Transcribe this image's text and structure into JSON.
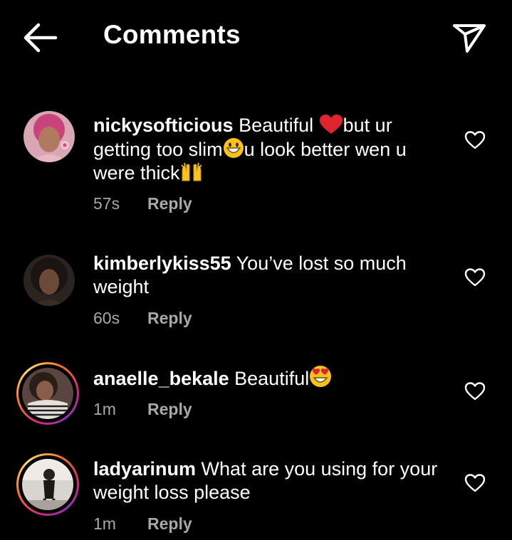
{
  "header": {
    "title": "Comments",
    "back_icon": "back-arrow-icon",
    "send_icon": "direct-send-icon"
  },
  "comments": [
    {
      "username": "nickysofticious",
      "text_1": " Beautiful ",
      "emoji_1": "red-heart",
      "text_2": "but ur getting too slim",
      "emoji_2": "grinning-face",
      "text_3": "u look better wen u were thick",
      "emoji_3": "raised-hands",
      "time": "57s",
      "reply_label": "Reply"
    },
    {
      "username": "kimberlykiss55",
      "text_1": " You’ve lost so much weight",
      "time": "60s",
      "reply_label": "Reply"
    },
    {
      "username": "anaelle_bekale",
      "text_1": " Beautiful",
      "emoji_1": "heart-eyes-face",
      "time": "1m",
      "reply_label": "Reply"
    },
    {
      "username": "ladyarinum",
      "text_1": " What are you using for your weight loss please",
      "time": "1m",
      "reply_label": "Reply"
    }
  ],
  "colors": {
    "background": "#000000",
    "text": "#ffffff",
    "secondary_text": "#a8a8a8",
    "story_ring": "#d62976"
  }
}
